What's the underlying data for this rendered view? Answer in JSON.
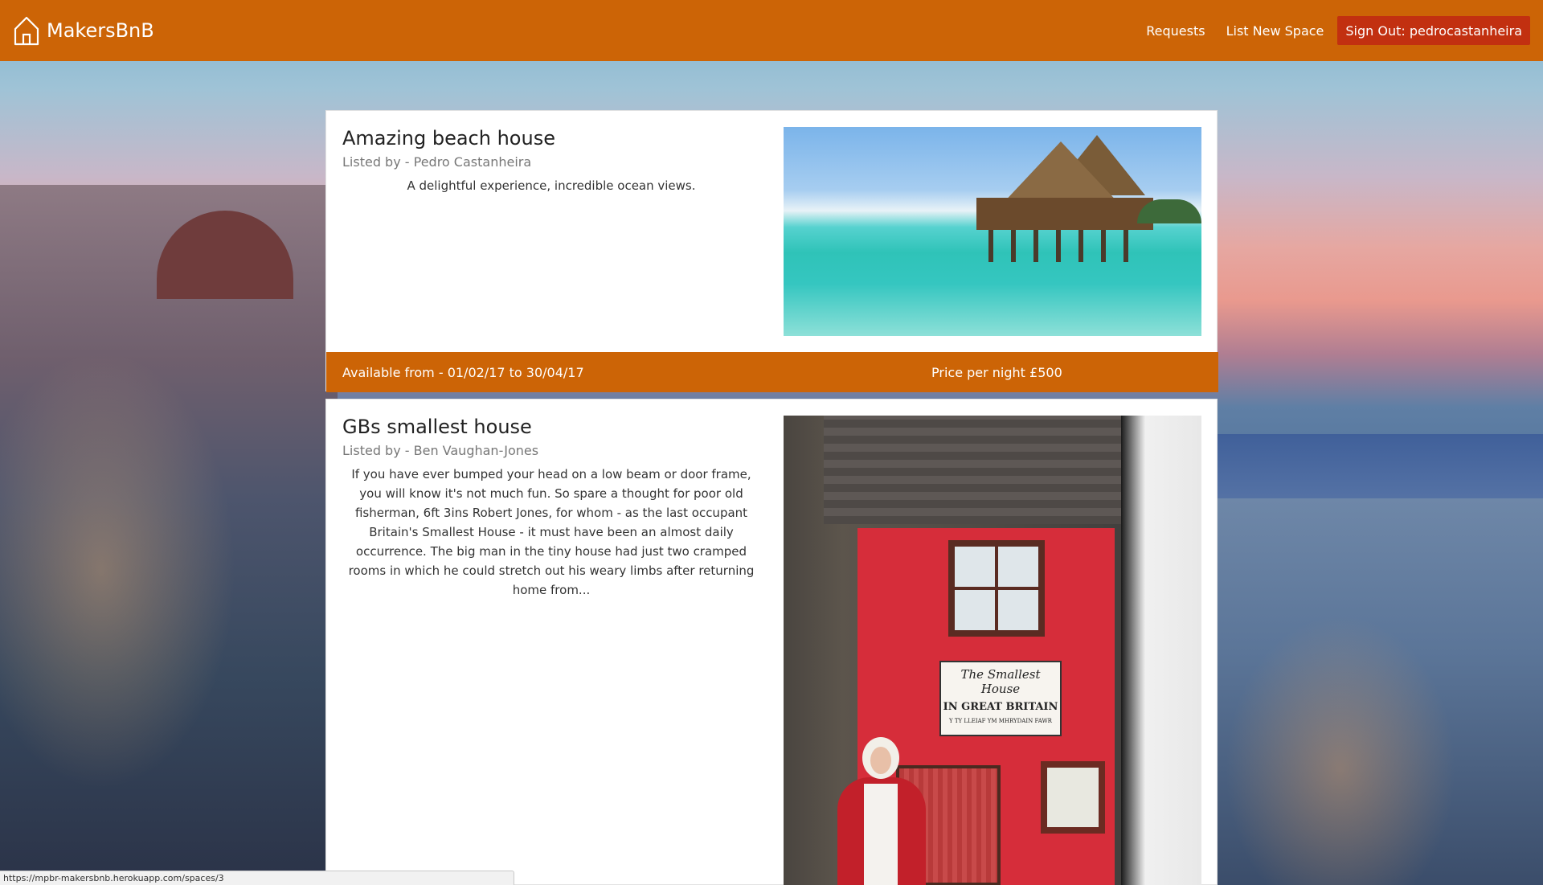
{
  "navbar": {
    "brand": "MakersBnB",
    "brand_icon": "house-outline-icon",
    "links": [
      "Requests",
      "List New Space"
    ],
    "signout_label": "Sign Out: pedrocastanheira",
    "background_color": "#cc6406",
    "signout_color": "#c23010"
  },
  "listings": [
    {
      "title": "Amazing beach house",
      "listed_by": "Listed by - Pedro Castanheira",
      "description": "A delightful experience, incredible ocean views.",
      "available": "Available from - 01/02/17 to 30/04/17",
      "price": "Price per night £500",
      "photo": "overwater-bungalow-photo"
    },
    {
      "title": "GBs smallest house",
      "listed_by": "Listed by - Ben Vaughan-Jones",
      "description": "If you have ever bumped your head on a low beam or door frame, you will know it's not much fun. So spare a thought for poor old fisherman, 6ft 3ins Robert Jones, for whom - as the last occupant Britain's Smallest House - it must have been an almost daily occurrence. The big man in the tiny house had just two cramped rooms in which he could stretch out his weary limbs after returning home from...",
      "photo": "smallest-house-photo",
      "sign": {
        "line1": "The Smallest House",
        "line2": "IN GREAT BRITAIN",
        "line3": "Y TY LLEIAF YM MHRYDAIN FAWR"
      }
    }
  ],
  "statusbar": {
    "url": "https://mpbr-makersbnb.herokuapp.com/spaces/3"
  }
}
